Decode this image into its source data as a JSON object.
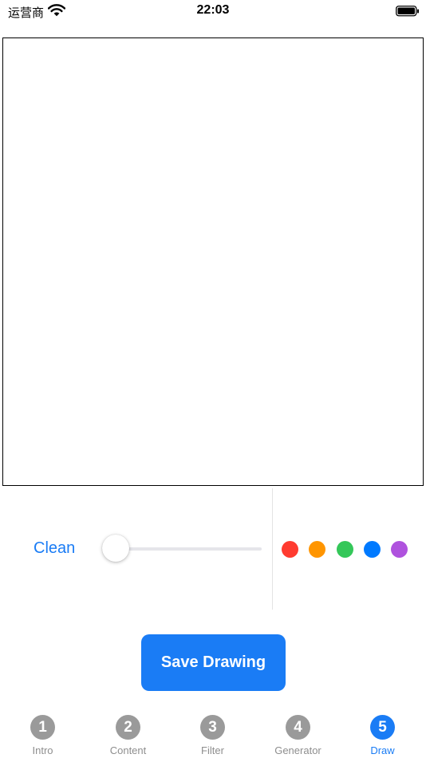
{
  "status_bar": {
    "carrier": "运营商",
    "time": "22:03"
  },
  "controls": {
    "clean_label": "Clean",
    "stroke_width": 0.0,
    "colors": [
      {
        "name": "red",
        "hex": "#ff3b30"
      },
      {
        "name": "orange",
        "hex": "#ff9500"
      },
      {
        "name": "green",
        "hex": "#34c759"
      },
      {
        "name": "blue",
        "hex": "#007aff"
      },
      {
        "name": "purple",
        "hex": "#af52de"
      }
    ]
  },
  "save_label": "Save Drawing",
  "tabs": [
    {
      "number": "1",
      "label": "Intro",
      "active": false
    },
    {
      "number": "2",
      "label": "Content",
      "active": false
    },
    {
      "number": "3",
      "label": "Filter",
      "active": false
    },
    {
      "number": "4",
      "label": "Generator",
      "active": false
    },
    {
      "number": "5",
      "label": "Draw",
      "active": true
    }
  ],
  "accent_color": "#1a7cf5"
}
